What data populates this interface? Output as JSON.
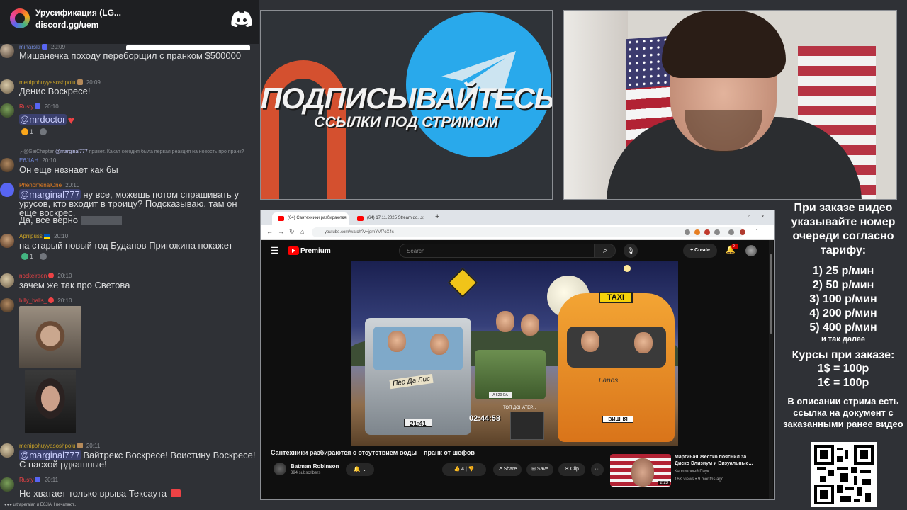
{
  "discord": {
    "server_name": "Урусификация (LG...",
    "invite": "discord.gg/uem",
    "messages": [
      {
        "user": "minarski",
        "time": "20:09",
        "text": "Мишанечка походу переборщил с пранком $500000"
      },
      {
        "user": "menipohuyyasoshpolu",
        "time": "20:09",
        "text": "Денис Воскресе!"
      },
      {
        "user": "Rusty",
        "time": "20:10",
        "mention": "@mrdoctor",
        "reactions": [
          "1",
          ""
        ]
      },
      {
        "reply_user": "@GaiChapter",
        "reply_mention": "@marginal777",
        "reply_text": "привет. Какая сегодня была первая реакция на новость про пранк?"
      },
      {
        "user": "E6JIAH",
        "time": "20:10",
        "text": "Он еще незнает как бы"
      },
      {
        "user": "PhenomenalOne",
        "time": "20:10",
        "mention": "@marginal777",
        "text": "ну все, можешь потом спрашивать у урусов, кто входит в троицу? Подсказываю, там он еще воскрес.",
        "text2": "Да, все верно"
      },
      {
        "user": "Aprilpuss",
        "time": "20:10",
        "text": "на старый новый год Буданов Пригожина покажет",
        "reactions": [
          "1",
          ""
        ]
      },
      {
        "user": "nockelraen",
        "time": "20:10",
        "text": "зачем же так про Светова"
      },
      {
        "user": "billy_balls_",
        "time": "20:10"
      },
      {
        "user": "menipohuyyasoshpolu",
        "time": "20:11",
        "mention": "@marginal777",
        "text": "Вайтрекс Воскресе! Воистину Воскресе! С пасхой рдкашные!"
      },
      {
        "user": "Rusty",
        "time": "20:11",
        "text": "Не хватает только врыва Тексаута"
      }
    ],
    "typing": "ultraperalan и E6JIAH печатают..."
  },
  "promo": {
    "title": "ПОДПИСЫВАЙТЕСЬ",
    "subtitle": "ССЫЛКИ ПОД СТРИМОМ"
  },
  "browser": {
    "tabs": [
      {
        "title": "(64) Сантехники разбираются"
      },
      {
        "title": "(64) 17.11.2025 Stream do..."
      }
    ],
    "new_tab": "+",
    "url": "youtube.com/watch?v=jgmYVf7oX4s",
    "yt": {
      "logo_text": "Premium",
      "search_placeholder": "Search",
      "create_label": "Create",
      "notif_count": "9+",
      "video_title": "Сантехники разбираются с отсутствием воды – пранк от шефов",
      "channel_name": "Batman Robinson",
      "channel_subs": "394 subscribers",
      "likes": "4",
      "share_label": "Share",
      "save_label": "Save",
      "clip_label": "Clip",
      "more_label": "···",
      "video": {
        "timestamp": "02:44:58",
        "truck_label": "Пёс Да Лис",
        "truck_plate": "21:41",
        "taxi_sign": "TAXI",
        "van_logo": "Lanos",
        "van_plate": "ВИШНЯ",
        "niva_plate": "А 520 ОА",
        "donater": "ТОП ДОНАТЕР..."
      },
      "recommendation": {
        "title": "Маргиная Жёстко пояснил за Диско Элизиум и Визуальные...",
        "channel": "Карликовый Паук",
        "meta": "16K views • 9 months ago",
        "duration": "2:23"
      }
    }
  },
  "prices": {
    "order_note": "При заказе видео указывайте номер очереди согласно тарифу:",
    "items": [
      "1) 25 р/мин",
      "2) 50 р/мин",
      "3) 100 р/мин",
      "4) 200 р/мин",
      "5) 400 р/мин"
    ],
    "and_more": "и так далее",
    "rates_title": "Курсы при заказе:",
    "rates": [
      "1$ = 100р",
      "1€ = 100р"
    ],
    "desc_note": "В описании стрима есть ссылка на документ с заказанными ранее видео"
  },
  "colors": {
    "discord_bg": "#2f3136",
    "mention_bg": "#5865f2",
    "yt_red": "#ff0000",
    "telegram_blue": "#29a9eb",
    "promo_orange": "#d4502f"
  }
}
